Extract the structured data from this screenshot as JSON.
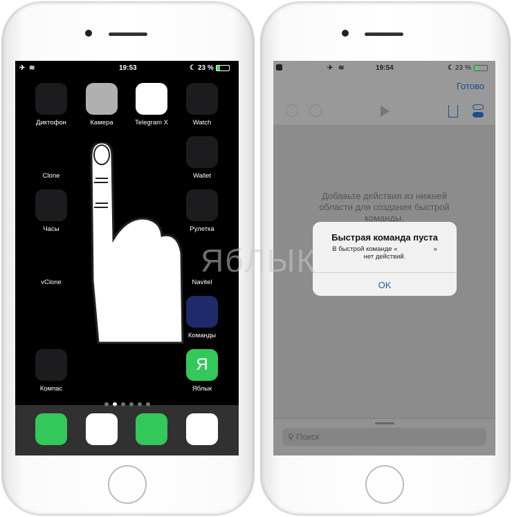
{
  "left": {
    "status": {
      "time": "19:53",
      "battery": "23 %"
    },
    "apps": [
      {
        "label": "Диктофон",
        "icon": "voice-memos-icon",
        "bg": "#1c1c1e"
      },
      {
        "label": "Камера",
        "icon": "camera-icon",
        "bg": "#b0b0b0"
      },
      {
        "label": "Telegram X",
        "icon": "telegram-icon",
        "bg": "#ffffff"
      },
      {
        "label": "Watch",
        "icon": "watch-icon",
        "bg": "#1c1c1e"
      },
      {
        "label": "Clone",
        "icon": "clone-icon",
        "bg": "#000000"
      },
      {
        "label": "Wallet",
        "icon": "wallet-icon",
        "bg": "#1c1c1e"
      },
      {
        "label": "Часы",
        "icon": "clock-icon",
        "bg": "#1c1c1e"
      },
      {
        "label": "Рулетка",
        "icon": "measure-icon",
        "bg": "#1c1c1e"
      },
      {
        "label": "vClone",
        "icon": "vclone-icon",
        "bg": "#000000"
      },
      {
        "label": "Navitel",
        "icon": "navitel-icon",
        "bg": "#000000"
      },
      {
        "label": "Команды",
        "icon": "shortcuts-icon",
        "bg": "#1f2a6b"
      },
      {
        "label": "Компас",
        "icon": "compass-icon",
        "bg": "#1c1c1e"
      },
      {
        "label": "Яблык",
        "icon": "yablyk-icon",
        "glyph": "Я",
        "bg": "#34c759"
      }
    ],
    "dock": [
      {
        "icon": "phone-icon",
        "bg": "#34c759"
      },
      {
        "icon": "safari-icon",
        "bg": "#ffffff"
      },
      {
        "icon": "messages-icon",
        "bg": "#34c759"
      },
      {
        "icon": "music-icon",
        "bg": "#ffffff"
      }
    ]
  },
  "right": {
    "status": {
      "time": "19:54",
      "battery": "23 %"
    },
    "done": "Готово",
    "empty_text": "Добавьте действия из нижней области для создания быстрой команды.",
    "alert": {
      "title": "Быстрая команда пуста",
      "message_1": "В быстрой команде «",
      "message_2": "»",
      "message_3": "нет действий.",
      "ok": "OK"
    },
    "search_placeholder": "Поиск",
    "accent": "#1a5fb4"
  },
  "watermark": "ЯбЛЫК"
}
